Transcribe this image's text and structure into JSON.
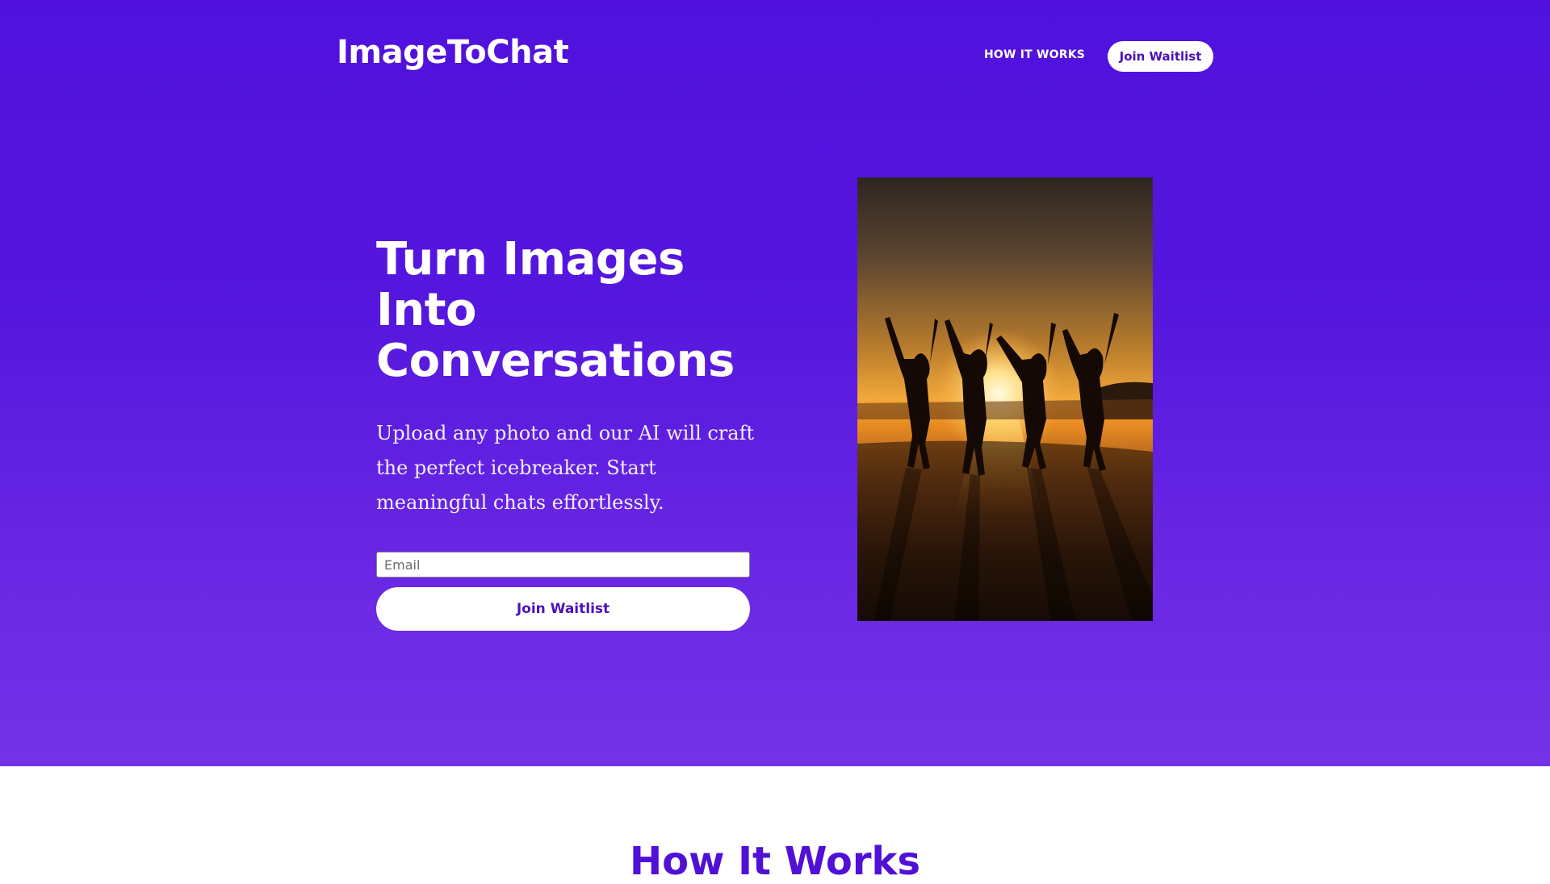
{
  "header": {
    "brand": "ImageToChat",
    "nav_how_it_works": "HOW IT WORKS",
    "nav_join_waitlist": "Join Waitlist"
  },
  "hero": {
    "headline": "Turn Images Into Conversations",
    "subtitle": "Upload any photo and our AI will craft the perfect icebreaker. Start meaningful chats effortlessly.",
    "email_placeholder": "Email",
    "email_value": "",
    "cta_label": "Join Waitlist",
    "image_subject": "silhouettes-jumping-at-beach-sunset"
  },
  "how_it_works": {
    "title": "How It Works"
  },
  "colors": {
    "hero_top": "#5011dd",
    "hero_bottom": "#7232e6",
    "accent_text": "#4b12b8",
    "section_title": "#5010d6"
  }
}
